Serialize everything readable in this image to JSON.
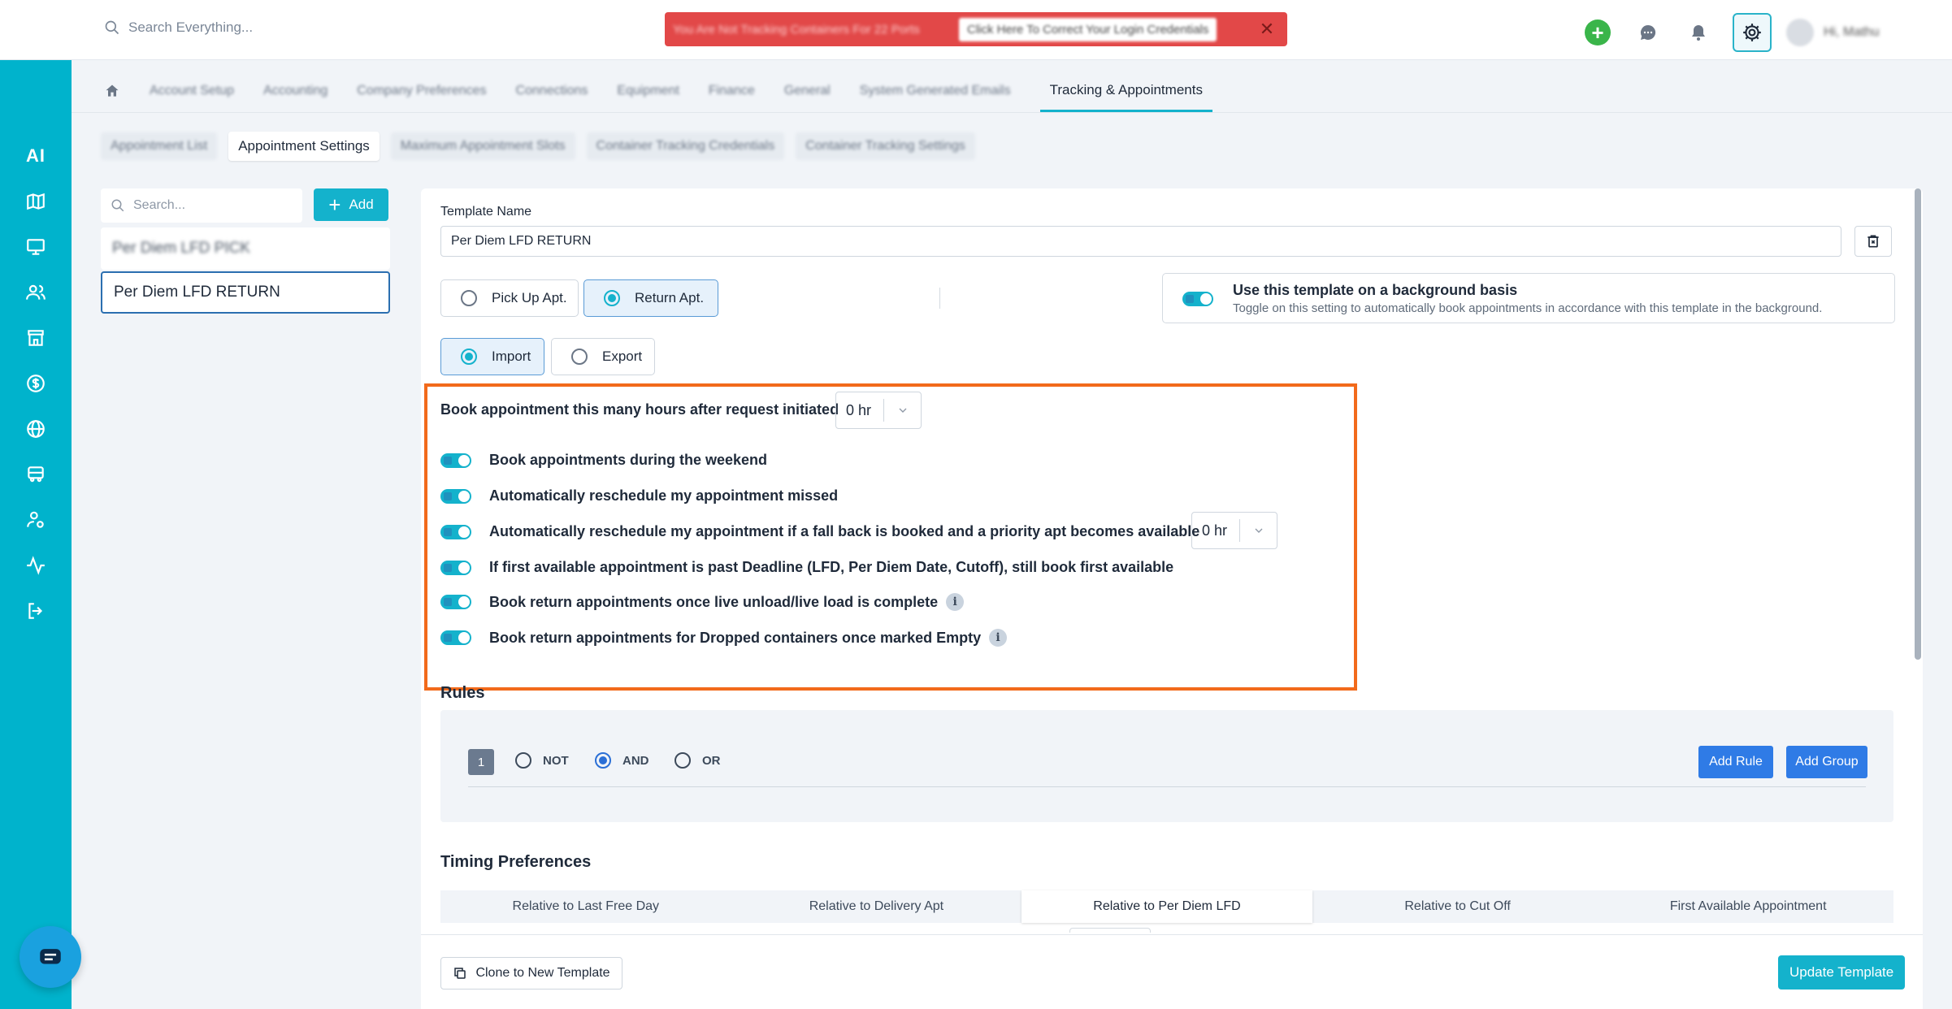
{
  "topbar": {
    "search_placeholder": "Search Everything...",
    "alert_text": "You Are Not Tracking Containers For 22 Ports",
    "alert_button": "Click Here To Correct Your Login Credentials",
    "alert_close": "✕",
    "user_name": "Hi, Mathu"
  },
  "sidebar": {
    "ai_label": "AI",
    "items": [
      "map-icon",
      "monitor-icon",
      "users-icon",
      "store-icon",
      "dollar-icon",
      "globe-icon",
      "truck-icon",
      "user-gear-icon",
      "activity-icon",
      "logout-icon"
    ]
  },
  "main_tabs": [
    {
      "label": "Account Setup",
      "blurred": true
    },
    {
      "label": "Accounting",
      "blurred": true
    },
    {
      "label": "Company Preferences",
      "blurred": true
    },
    {
      "label": "Connections",
      "blurred": true
    },
    {
      "label": "Equipment",
      "blurred": true
    },
    {
      "label": "Finance",
      "blurred": true
    },
    {
      "label": "General",
      "blurred": true
    },
    {
      "label": "System Generated Emails",
      "blurred": true
    },
    {
      "label": "Tracking & Appointments",
      "active": true
    }
  ],
  "sub_tabs": [
    {
      "label": "Appointment List",
      "blurred": true
    },
    {
      "label": "Appointment Settings",
      "active": true
    },
    {
      "label": "Maximum Appointment Slots",
      "blurred": true
    },
    {
      "label": "Container Tracking Credentials",
      "blurred": true
    },
    {
      "label": "Container Tracking Settings",
      "blurred": true
    }
  ],
  "left": {
    "search_placeholder": "Search...",
    "add_label": "Add",
    "templates": [
      {
        "name": "Per Diem LFD PICK",
        "blurred": true
      },
      {
        "name": "Per Diem LFD RETURN",
        "active": true
      }
    ]
  },
  "form": {
    "template_name_label": "Template Name",
    "template_name_value": "Per Diem LFD RETURN",
    "apt_types": [
      {
        "label": "Pick Up Apt.",
        "selected": false
      },
      {
        "label": "Return Apt.",
        "selected": true
      }
    ],
    "directions": [
      {
        "label": "Import",
        "selected": true
      },
      {
        "label": "Export",
        "selected": false
      }
    ],
    "background": {
      "title": "Use this template on a background basis",
      "subtitle": "Toggle on this setting to automatically book appointments in accordance with this template in the background.",
      "enabled": true
    },
    "hours_label": "Book appointment this many hours after request initiated",
    "hours_value": "0 hr",
    "options": [
      {
        "label": "Book appointments during the weekend",
        "enabled": true
      },
      {
        "label": "Automatically reschedule my appointment missed",
        "enabled": true
      },
      {
        "label": "Automatically reschedule my appointment if a fall back is booked and a priority apt becomes available",
        "enabled": true,
        "select_value": "0 hr"
      },
      {
        "label": "If first available appointment is past Deadline (LFD, Per Diem Date, Cutoff), still book first available",
        "enabled": true
      },
      {
        "label": "Book return appointments once live unload/live load is complete",
        "enabled": true,
        "info": "i"
      },
      {
        "label": "Book return appointments for Dropped containers once marked Empty",
        "enabled": true,
        "info": "i"
      }
    ]
  },
  "rules": {
    "title": "Rules",
    "group_number": "1",
    "operators": [
      {
        "label": "NOT",
        "selected": false
      },
      {
        "label": "AND",
        "selected": true
      },
      {
        "label": "OR",
        "selected": false
      }
    ],
    "add_rule": "Add Rule",
    "add_group": "Add Group"
  },
  "timing": {
    "title": "Timing Preferences",
    "tabs": [
      {
        "label": "Relative to Last Free Day"
      },
      {
        "label": "Relative to Delivery Apt"
      },
      {
        "label": "Relative to Per Diem LFD",
        "active": true
      },
      {
        "label": "Relative to Cut Off"
      },
      {
        "label": "First Available Appointment"
      }
    ]
  },
  "footer": {
    "clone_label": "Clone to New Template",
    "update_label": "Update Template"
  },
  "colors": {
    "accent": "#14b2cc",
    "highlight": "#f26a1b",
    "alert": "#e24848",
    "primary_blue": "#2f7be6"
  }
}
